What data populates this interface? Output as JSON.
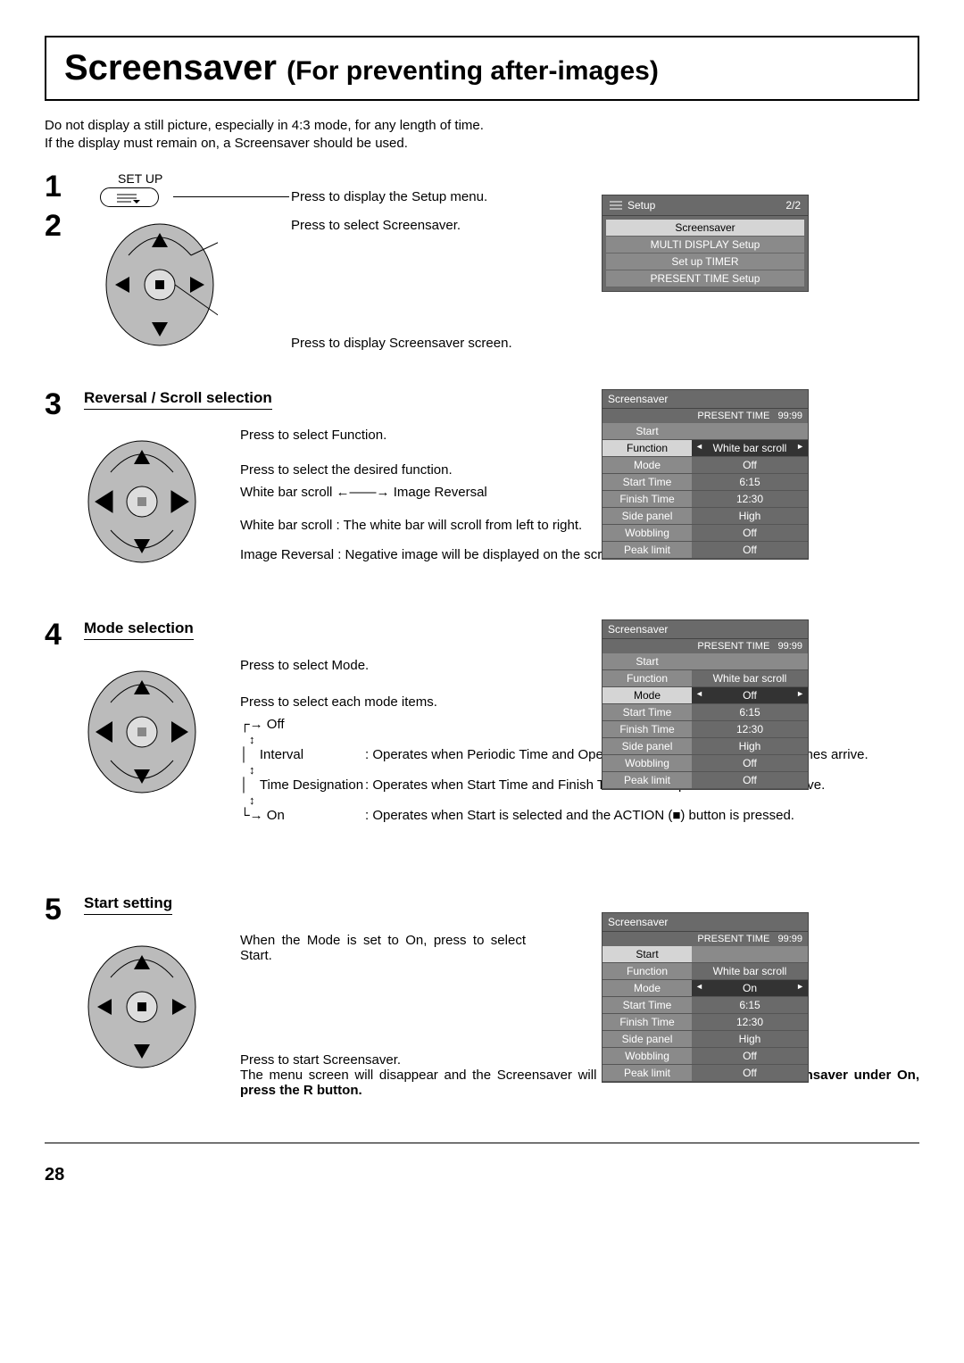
{
  "title_main": "Screensaver ",
  "title_sub": "(For preventing after-images)",
  "intro1": "Do not display a still picture, especially in 4:3 mode, for any length of time.",
  "intro2": "If the display must remain on, a Screensaver should be used.",
  "page_number": "28",
  "step1": {
    "label": "SET UP",
    "desc": "Press to display the Setup menu."
  },
  "step2": {
    "desc1": "Press to select Screensaver.",
    "desc2": "Press to display Screensaver screen."
  },
  "osd1": {
    "title": "Setup",
    "page": "2/2",
    "items": [
      "Screensaver",
      "MULTI DISPLAY Setup",
      "Set up TIMER",
      "PRESENT TIME Setup"
    ]
  },
  "step3": {
    "heading": "Reversal / Scroll selection",
    "d1": "Press to select Function.",
    "d2": "Press to select the desired function.",
    "left_opt": "White bar scroll",
    "right_opt": "Image Reversal",
    "note1": "White bar scroll : The white bar will scroll from left to right.",
    "note2": "Image Reversal : Negative image will be displayed on the screen."
  },
  "osd2": {
    "title": "Screensaver",
    "pt_label": "PRESENT  TIME",
    "pt_value": "99:99",
    "rows": [
      {
        "label": "Start",
        "value": "",
        "start": true
      },
      {
        "label": "Function",
        "value": "White bar scroll",
        "sel": true,
        "selrow": true
      },
      {
        "label": "Mode",
        "value": "Off"
      },
      {
        "label": "Start Time",
        "value": "6:15"
      },
      {
        "label": "Finish Time",
        "value": "12:30"
      },
      {
        "label": "Side panel",
        "value": "High"
      },
      {
        "label": "Wobbling",
        "value": "Off"
      },
      {
        "label": "Peak limit",
        "value": "Off"
      }
    ]
  },
  "step4": {
    "heading": "Mode selection",
    "d1": "Press to select Mode.",
    "d2": "Press to select each mode items.",
    "modes": {
      "off": "Off",
      "interval": "Interval",
      "interval_desc": ": Operates when Periodic Time and Operating Time are setup and those times arrive.",
      "timed": "Time Designation",
      "timed_desc": ": Operates when Start Time and Finish Time are setup and those times arrive.",
      "on": "On",
      "on_desc": ": Operates when Start is selected and the ACTION (■) button is pressed."
    }
  },
  "osd3": {
    "title": "Screensaver",
    "pt_label": "PRESENT  TIME",
    "pt_value": "99:99",
    "rows": [
      {
        "label": "Start",
        "value": "",
        "start": true
      },
      {
        "label": "Function",
        "value": "White bar scroll"
      },
      {
        "label": "Mode",
        "value": "Off",
        "sel": true,
        "selrow": true
      },
      {
        "label": "Start Time",
        "value": "6:15"
      },
      {
        "label": "Finish Time",
        "value": "12:30"
      },
      {
        "label": "Side panel",
        "value": "High"
      },
      {
        "label": "Wobbling",
        "value": "Off"
      },
      {
        "label": "Peak limit",
        "value": "Off"
      }
    ]
  },
  "step5": {
    "heading": "Start setting",
    "d1": "When the Mode is set to On, press to select Start.",
    "d2": "Press to start Screensaver.",
    "d3a": "The menu screen will disappear and the Screensaver will be activated. ",
    "d3b": "To stop the Screensaver under On, press the R button."
  },
  "osd4": {
    "title": "Screensaver",
    "pt_label": "PRESENT  TIME",
    "pt_value": "99:99",
    "rows": [
      {
        "label": "Start",
        "value": "",
        "start": true,
        "selrow": true
      },
      {
        "label": "Function",
        "value": "White bar scroll"
      },
      {
        "label": "Mode",
        "value": "On",
        "sel": true
      },
      {
        "label": "Start Time",
        "value": "6:15"
      },
      {
        "label": "Finish Time",
        "value": "12:30"
      },
      {
        "label": "Side panel",
        "value": "High"
      },
      {
        "label": "Wobbling",
        "value": "Off"
      },
      {
        "label": "Peak limit",
        "value": "Off"
      }
    ]
  }
}
